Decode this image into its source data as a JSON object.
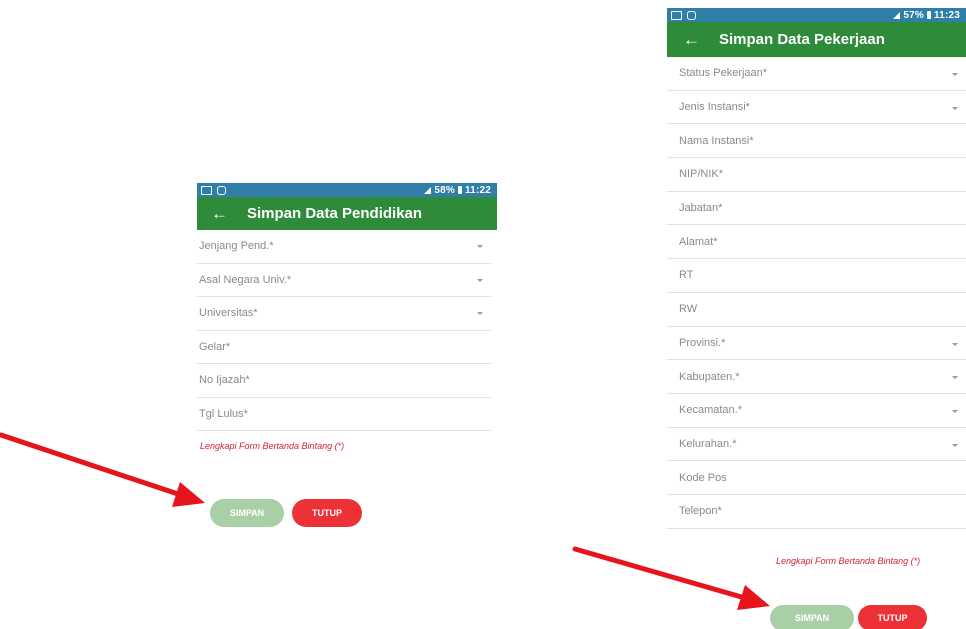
{
  "left_screen": {
    "status": {
      "time": "11:22",
      "battery": "58%"
    },
    "title": "Simpan Data Pendidikan",
    "fields": [
      {
        "label": "Jenjang Pend.*",
        "dropdown": true
      },
      {
        "label": "Asal Negara Univ.*",
        "dropdown": true
      },
      {
        "label": "Universitas*",
        "dropdown": true
      },
      {
        "label": "Gelar*",
        "dropdown": false
      },
      {
        "label": "No Ijazah*",
        "dropdown": false
      },
      {
        "label": "Tgl Lulus*",
        "dropdown": false
      }
    ],
    "note": "Lengkapi Form Bertanda Bintang (*)",
    "save_label": "SIMPAN",
    "close_label": "TUTUP"
  },
  "right_screen": {
    "status": {
      "time": "11:23",
      "battery": "57%"
    },
    "title": "Simpan Data Pekerjaan",
    "fields": [
      {
        "label": "Status Pekerjaan*",
        "dropdown": true
      },
      {
        "label": "Jenis Instansi*",
        "dropdown": true
      },
      {
        "label": "Nama Instansi*",
        "dropdown": false
      },
      {
        "label": "NIP/NIK*",
        "dropdown": false
      },
      {
        "label": "Jabatan*",
        "dropdown": false
      },
      {
        "label": "Alamat*",
        "dropdown": false
      },
      {
        "label": "RT",
        "dropdown": false
      },
      {
        "label": "RW",
        "dropdown": false
      },
      {
        "label": "Provinsi.*",
        "dropdown": true
      },
      {
        "label": "Kabupaten.*",
        "dropdown": true
      },
      {
        "label": "Kecamatan.*",
        "dropdown": true
      },
      {
        "label": "Kelurahan.*",
        "dropdown": true
      },
      {
        "label": "Kode Pos",
        "dropdown": false
      },
      {
        "label": "Telepon*",
        "dropdown": false
      }
    ],
    "note": "Lengkapi Form Bertanda Bintang (*)",
    "save_label": "SIMPAN",
    "close_label": "TUTUP"
  },
  "colors": {
    "app_bar": "#2e8b3a",
    "status_bar": "#2f7fa8",
    "save_button": "#a9cfa7",
    "close_button": "#ed3237",
    "annotation_arrow": "#e8141c"
  }
}
